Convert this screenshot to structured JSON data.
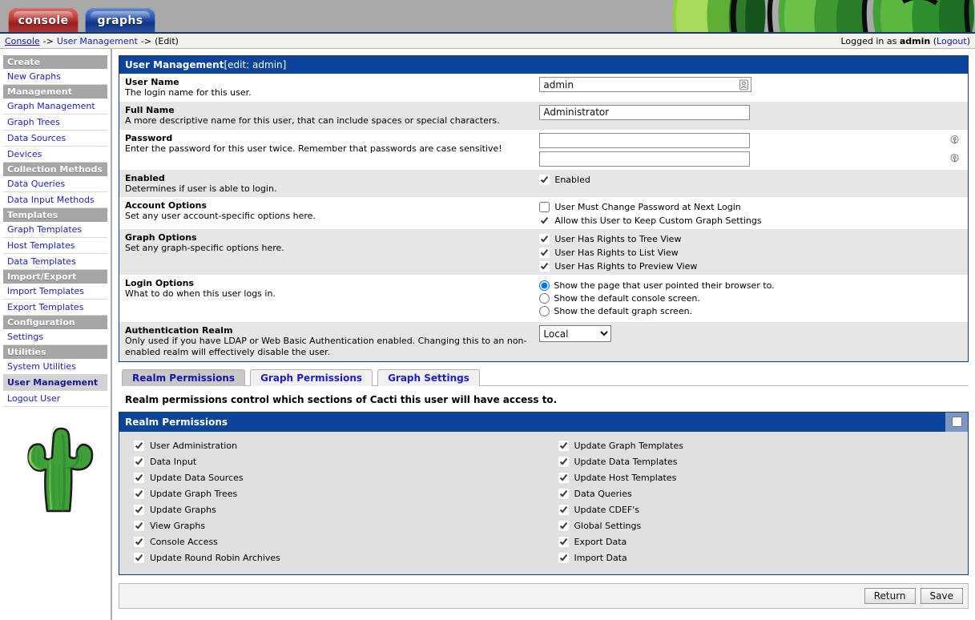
{
  "banner": {
    "art": "cactus-banner-graphic"
  },
  "top_tabs": [
    {
      "label": "console",
      "name": "tab-console",
      "active": false
    },
    {
      "label": "graphs",
      "name": "tab-graphs",
      "active": true
    }
  ],
  "breadcrumb": {
    "console": "Console",
    "sep1": "->",
    "section": "User Management",
    "sep2": "->",
    "current": "(Edit)",
    "logged_prefix": "Logged in as",
    "logged_user": "admin",
    "logout_open": "(",
    "logout": "Logout",
    "logout_close": ")"
  },
  "sidebar": {
    "groups": [
      {
        "header": "Create",
        "items": [
          "New Graphs"
        ]
      },
      {
        "header": "Management",
        "items": [
          "Graph Management",
          "Graph Trees",
          "Data Sources",
          "Devices"
        ]
      },
      {
        "header": "Collection Methods",
        "items": [
          "Data Queries",
          "Data Input Methods"
        ]
      },
      {
        "header": "Templates",
        "items": [
          "Graph Templates",
          "Host Templates",
          "Data Templates"
        ]
      },
      {
        "header": "Import/Export",
        "items": [
          "Import Templates",
          "Export Templates"
        ]
      },
      {
        "header": "Configuration",
        "items": [
          "Settings"
        ]
      },
      {
        "header": "Utilities",
        "items": [
          "System Utilities",
          "User Management",
          "Logout User"
        ]
      }
    ],
    "active_item": "User Management",
    "logo": "cactus-logo"
  },
  "form": {
    "title_bold": "User Management",
    "title_light": " [edit: admin]",
    "rows": [
      {
        "label": "User Name",
        "desc": "The login name for this user.",
        "type": "text",
        "value": "admin",
        "icon": "user-card-icon"
      },
      {
        "label": "Full Name",
        "desc": "A more descriptive name for this user, that can include spaces or special characters.",
        "type": "text",
        "value": "Administrator",
        "icon": ""
      },
      {
        "label": "Password",
        "desc": "Enter the password for this user twice. Remember that passwords are case sensitive!",
        "type": "password2",
        "value": "",
        "value2": "",
        "icon": "key-icon"
      },
      {
        "label": "Enabled",
        "desc": "Determines if user is able to login.",
        "type": "checks",
        "checks": [
          {
            "label": "Enabled",
            "checked": true
          }
        ]
      },
      {
        "label": "Account Options",
        "desc": "Set any user account-specific options here.",
        "type": "checks",
        "checks": [
          {
            "label": "User Must Change Password at Next Login",
            "checked": false
          },
          {
            "label": "Allow this User to Keep Custom Graph Settings",
            "checked": true
          }
        ]
      },
      {
        "label": "Graph Options",
        "desc": "Set any graph-specific options here.",
        "type": "checks",
        "checks": [
          {
            "label": "User Has Rights to Tree View",
            "checked": true
          },
          {
            "label": "User Has Rights to List View",
            "checked": true
          },
          {
            "label": "User Has Rights to Preview View",
            "checked": true
          }
        ]
      },
      {
        "label": "Login Options",
        "desc": "What to do when this user logs in.",
        "type": "radios",
        "radios": [
          {
            "label": "Show the page that user pointed their browser to.",
            "checked": true
          },
          {
            "label": "Show the default console screen.",
            "checked": false
          },
          {
            "label": "Show the default graph screen.",
            "checked": false
          }
        ]
      },
      {
        "label": "Authentication Realm",
        "desc": "Only used if you have LDAP or Web Basic Authentication enabled. Changing this to an non-enabled realm will effectively disable the user.",
        "type": "select",
        "value": "Local",
        "options": [
          "Local"
        ]
      }
    ]
  },
  "subtabs": [
    {
      "label": "Realm Permissions",
      "active": true
    },
    {
      "label": "Graph Permissions",
      "active": false
    },
    {
      "label": "Graph Settings",
      "active": false
    }
  ],
  "blurb": "Realm permissions control which sections of Cacti this user will have access to.",
  "permissions": {
    "panel_title": "Realm Permissions",
    "select_all_checked": false,
    "left": [
      {
        "label": "User Administration",
        "checked": true
      },
      {
        "label": "Data Input",
        "checked": true
      },
      {
        "label": "Update Data Sources",
        "checked": true
      },
      {
        "label": "Update Graph Trees",
        "checked": true
      },
      {
        "label": "Update Graphs",
        "checked": true
      },
      {
        "label": "View Graphs",
        "checked": true
      },
      {
        "label": "Console Access",
        "checked": true
      },
      {
        "label": "Update Round Robin Archives",
        "checked": true
      }
    ],
    "right": [
      {
        "label": "Update Graph Templates",
        "checked": true
      },
      {
        "label": "Update Data Templates",
        "checked": true
      },
      {
        "label": "Update Host Templates",
        "checked": true
      },
      {
        "label": "Data Queries",
        "checked": true
      },
      {
        "label": "Update CDEF's",
        "checked": true
      },
      {
        "label": "Global Settings",
        "checked": true
      },
      {
        "label": "Export Data",
        "checked": true
      },
      {
        "label": "Import Data",
        "checked": true
      }
    ]
  },
  "footer": {
    "return_label": "Return",
    "save_label": "Save"
  },
  "colors": {
    "panel_blue": "#0b4498",
    "header_gray": "#a6a6a6",
    "link_blue": "#2222bb",
    "row_alt": "#e6e6e6",
    "perm_body": "#e0e0e0"
  }
}
